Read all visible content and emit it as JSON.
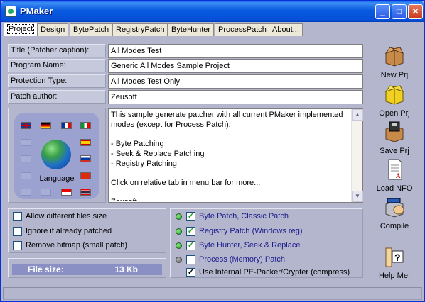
{
  "window": {
    "title": "PMaker",
    "minimize": "_",
    "maximize": "□",
    "close": "✕"
  },
  "tabs": [
    "Project",
    "Design",
    "BytePatch",
    "RegistryPatch",
    "ByteHunter",
    "ProcessPatch",
    "About..."
  ],
  "active_tab": "Project",
  "form": {
    "title_label": "Title (Patcher caption):",
    "title_value": "All Modes Test",
    "program_label": "Program Name:",
    "program_value": "Generic All Modes Sample Project",
    "protection_label": "Protection Type:",
    "protection_value": "All Modes Test Only",
    "author_label": "Patch author:",
    "author_value": "Zeusoft"
  },
  "language": {
    "label": "Language"
  },
  "description": "This sample generate patcher with all current PMaker implemented\nmodes (except for Process Patch):\n\n- Byte Patching\n- Seek & Replace Patching\n- Registry Patching\n\nClick on relative tab in menu bar for more...\n\nZeusoft",
  "options": [
    {
      "label": "Allow different files size",
      "checked": false
    },
    {
      "label": "Ignore if already patched",
      "checked": false
    },
    {
      "label": "Remove bitmap (small patch)",
      "checked": false
    }
  ],
  "filesize": {
    "label": "File size:",
    "value": "13 Kb"
  },
  "modes": [
    {
      "label": "Byte Patch, Classic Patch",
      "checked": true,
      "led": "on"
    },
    {
      "label": "Registry Patch (Windows reg)",
      "checked": true,
      "led": "on"
    },
    {
      "label": "Byte Hunter, Seek & Replace",
      "checked": true,
      "led": "on"
    },
    {
      "label": "Process (Memory) Patch",
      "checked": false,
      "led": "off"
    },
    {
      "label": "Use Internal PE-Packer/Crypter (compress)",
      "checked": true,
      "led": "none"
    }
  ],
  "side_buttons": [
    {
      "label": "New Prj",
      "icon": "open-box-icon"
    },
    {
      "label": "Open Prj",
      "icon": "yellow-box-icon"
    },
    {
      "label": "Save Prj",
      "icon": "floppy-box-icon"
    },
    {
      "label": "Load NFO",
      "icon": "document-icon"
    },
    {
      "label": "Compile",
      "icon": "hand-box-icon"
    },
    {
      "label": "Help Me!",
      "icon": "help-icon"
    }
  ],
  "colors": {
    "panel": "#b4b6ce",
    "accent": "#0a5ee8",
    "led_on": "#1a9a1a",
    "filesize_bar": "#8a8fc4"
  }
}
